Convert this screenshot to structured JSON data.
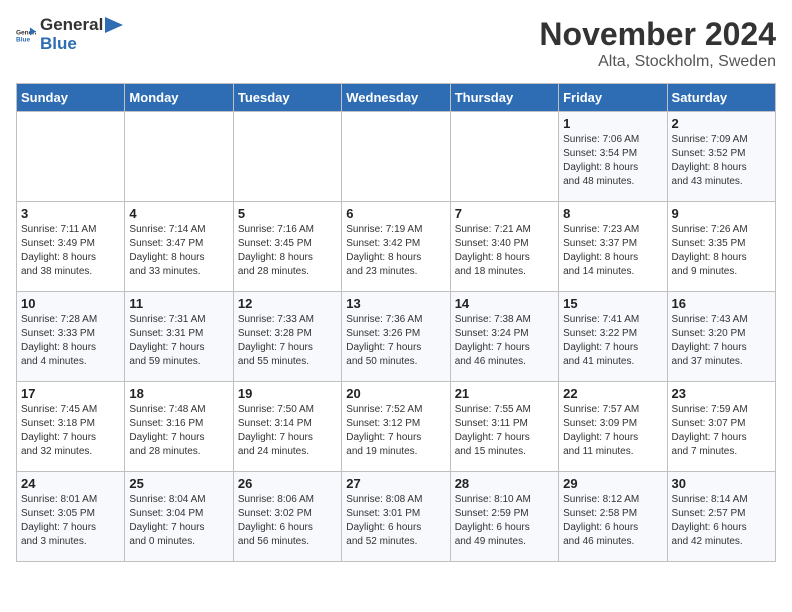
{
  "header": {
    "logo_general": "General",
    "logo_blue": "Blue",
    "month_title": "November 2024",
    "location": "Alta, Stockholm, Sweden"
  },
  "weekdays": [
    "Sunday",
    "Monday",
    "Tuesday",
    "Wednesday",
    "Thursday",
    "Friday",
    "Saturday"
  ],
  "weeks": [
    [
      {
        "day": "",
        "info": ""
      },
      {
        "day": "",
        "info": ""
      },
      {
        "day": "",
        "info": ""
      },
      {
        "day": "",
        "info": ""
      },
      {
        "day": "",
        "info": ""
      },
      {
        "day": "1",
        "info": "Sunrise: 7:06 AM\nSunset: 3:54 PM\nDaylight: 8 hours\nand 48 minutes."
      },
      {
        "day": "2",
        "info": "Sunrise: 7:09 AM\nSunset: 3:52 PM\nDaylight: 8 hours\nand 43 minutes."
      }
    ],
    [
      {
        "day": "3",
        "info": "Sunrise: 7:11 AM\nSunset: 3:49 PM\nDaylight: 8 hours\nand 38 minutes."
      },
      {
        "day": "4",
        "info": "Sunrise: 7:14 AM\nSunset: 3:47 PM\nDaylight: 8 hours\nand 33 minutes."
      },
      {
        "day": "5",
        "info": "Sunrise: 7:16 AM\nSunset: 3:45 PM\nDaylight: 8 hours\nand 28 minutes."
      },
      {
        "day": "6",
        "info": "Sunrise: 7:19 AM\nSunset: 3:42 PM\nDaylight: 8 hours\nand 23 minutes."
      },
      {
        "day": "7",
        "info": "Sunrise: 7:21 AM\nSunset: 3:40 PM\nDaylight: 8 hours\nand 18 minutes."
      },
      {
        "day": "8",
        "info": "Sunrise: 7:23 AM\nSunset: 3:37 PM\nDaylight: 8 hours\nand 14 minutes."
      },
      {
        "day": "9",
        "info": "Sunrise: 7:26 AM\nSunset: 3:35 PM\nDaylight: 8 hours\nand 9 minutes."
      }
    ],
    [
      {
        "day": "10",
        "info": "Sunrise: 7:28 AM\nSunset: 3:33 PM\nDaylight: 8 hours\nand 4 minutes."
      },
      {
        "day": "11",
        "info": "Sunrise: 7:31 AM\nSunset: 3:31 PM\nDaylight: 7 hours\nand 59 minutes."
      },
      {
        "day": "12",
        "info": "Sunrise: 7:33 AM\nSunset: 3:28 PM\nDaylight: 7 hours\nand 55 minutes."
      },
      {
        "day": "13",
        "info": "Sunrise: 7:36 AM\nSunset: 3:26 PM\nDaylight: 7 hours\nand 50 minutes."
      },
      {
        "day": "14",
        "info": "Sunrise: 7:38 AM\nSunset: 3:24 PM\nDaylight: 7 hours\nand 46 minutes."
      },
      {
        "day": "15",
        "info": "Sunrise: 7:41 AM\nSunset: 3:22 PM\nDaylight: 7 hours\nand 41 minutes."
      },
      {
        "day": "16",
        "info": "Sunrise: 7:43 AM\nSunset: 3:20 PM\nDaylight: 7 hours\nand 37 minutes."
      }
    ],
    [
      {
        "day": "17",
        "info": "Sunrise: 7:45 AM\nSunset: 3:18 PM\nDaylight: 7 hours\nand 32 minutes."
      },
      {
        "day": "18",
        "info": "Sunrise: 7:48 AM\nSunset: 3:16 PM\nDaylight: 7 hours\nand 28 minutes."
      },
      {
        "day": "19",
        "info": "Sunrise: 7:50 AM\nSunset: 3:14 PM\nDaylight: 7 hours\nand 24 minutes."
      },
      {
        "day": "20",
        "info": "Sunrise: 7:52 AM\nSunset: 3:12 PM\nDaylight: 7 hours\nand 19 minutes."
      },
      {
        "day": "21",
        "info": "Sunrise: 7:55 AM\nSunset: 3:11 PM\nDaylight: 7 hours\nand 15 minutes."
      },
      {
        "day": "22",
        "info": "Sunrise: 7:57 AM\nSunset: 3:09 PM\nDaylight: 7 hours\nand 11 minutes."
      },
      {
        "day": "23",
        "info": "Sunrise: 7:59 AM\nSunset: 3:07 PM\nDaylight: 7 hours\nand 7 minutes."
      }
    ],
    [
      {
        "day": "24",
        "info": "Sunrise: 8:01 AM\nSunset: 3:05 PM\nDaylight: 7 hours\nand 3 minutes."
      },
      {
        "day": "25",
        "info": "Sunrise: 8:04 AM\nSunset: 3:04 PM\nDaylight: 7 hours\nand 0 minutes."
      },
      {
        "day": "26",
        "info": "Sunrise: 8:06 AM\nSunset: 3:02 PM\nDaylight: 6 hours\nand 56 minutes."
      },
      {
        "day": "27",
        "info": "Sunrise: 8:08 AM\nSunset: 3:01 PM\nDaylight: 6 hours\nand 52 minutes."
      },
      {
        "day": "28",
        "info": "Sunrise: 8:10 AM\nSunset: 2:59 PM\nDaylight: 6 hours\nand 49 minutes."
      },
      {
        "day": "29",
        "info": "Sunrise: 8:12 AM\nSunset: 2:58 PM\nDaylight: 6 hours\nand 46 minutes."
      },
      {
        "day": "30",
        "info": "Sunrise: 8:14 AM\nSunset: 2:57 PM\nDaylight: 6 hours\nand 42 minutes."
      }
    ]
  ]
}
